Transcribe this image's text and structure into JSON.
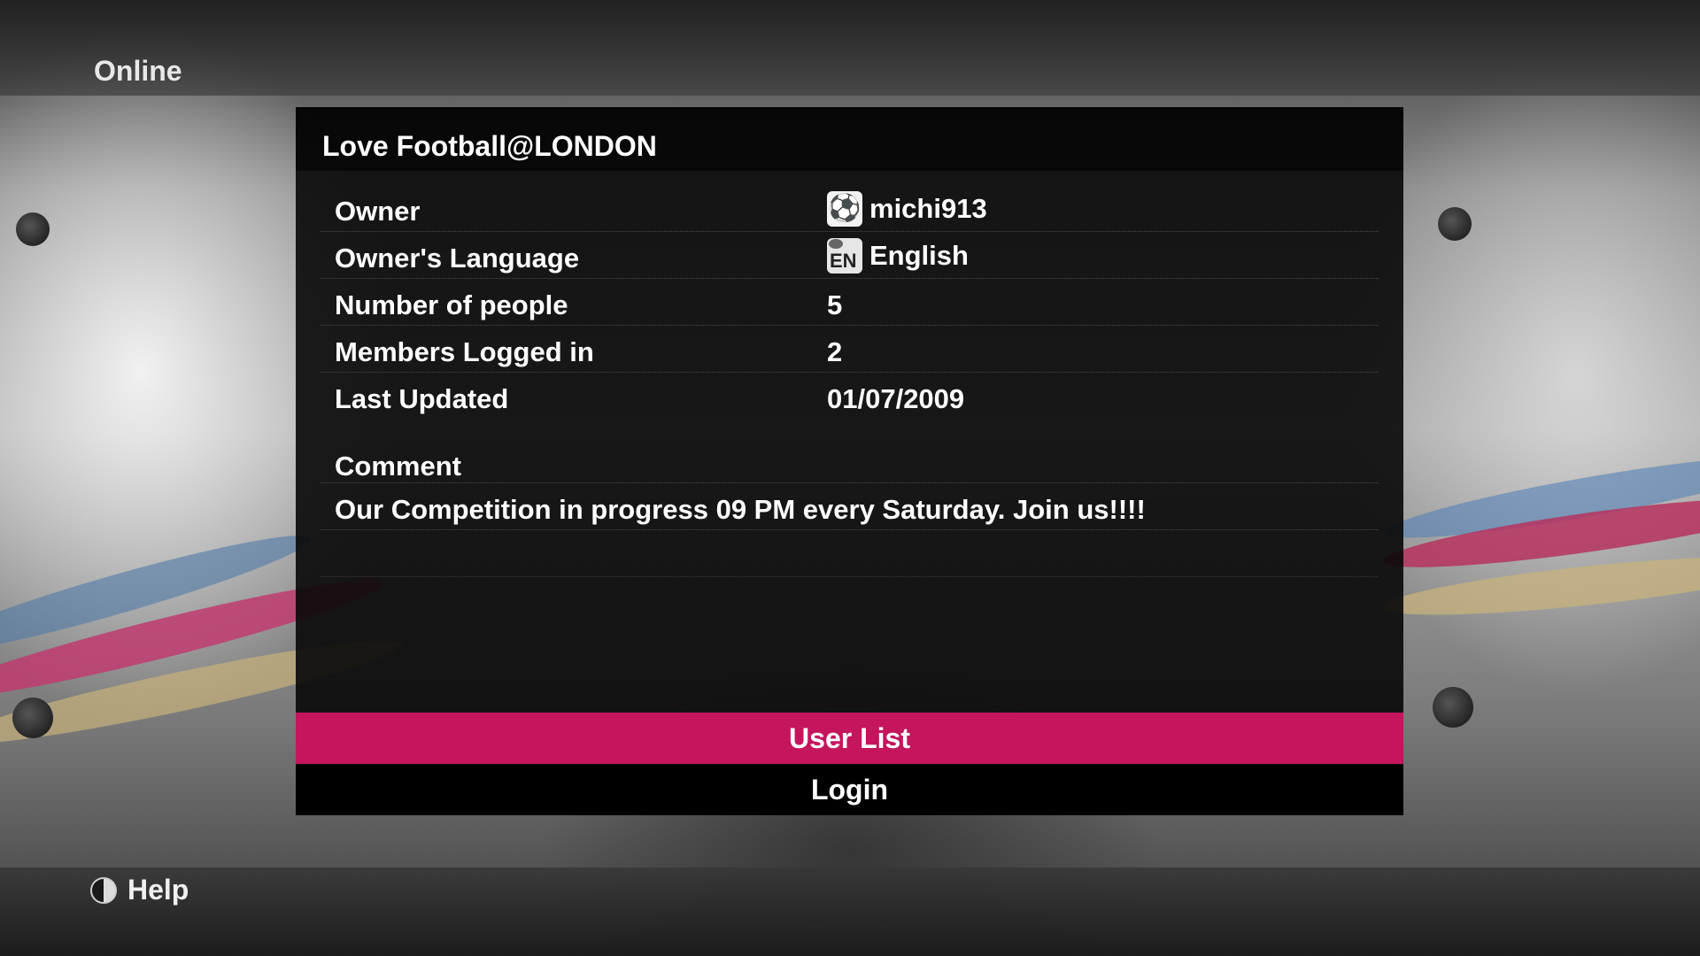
{
  "header": {
    "title": "Online"
  },
  "panel": {
    "title": "Love Football@LONDON",
    "rows": [
      {
        "label": "Owner",
        "value": "michi913",
        "icon": "soccer-ball-icon"
      },
      {
        "label": "Owner's Language",
        "value": "English",
        "icon": "language-en-icon",
        "icon_text": "EN"
      },
      {
        "label": "Number of people",
        "value": "5"
      },
      {
        "label": "Members Logged in",
        "value": "2"
      },
      {
        "label": "Last Updated",
        "value": "01/07/2009"
      }
    ],
    "comment_label": "Comment",
    "comment_text": "Our Competition in progress 09 PM every Saturday. Join us!!!!"
  },
  "buttons": {
    "user_list": "User List",
    "login": "Login"
  },
  "footer": {
    "help_label": "Help",
    "help_icon": "half-circle-button-icon"
  },
  "colors": {
    "accent": "#c4155d",
    "panel": "#080808"
  }
}
